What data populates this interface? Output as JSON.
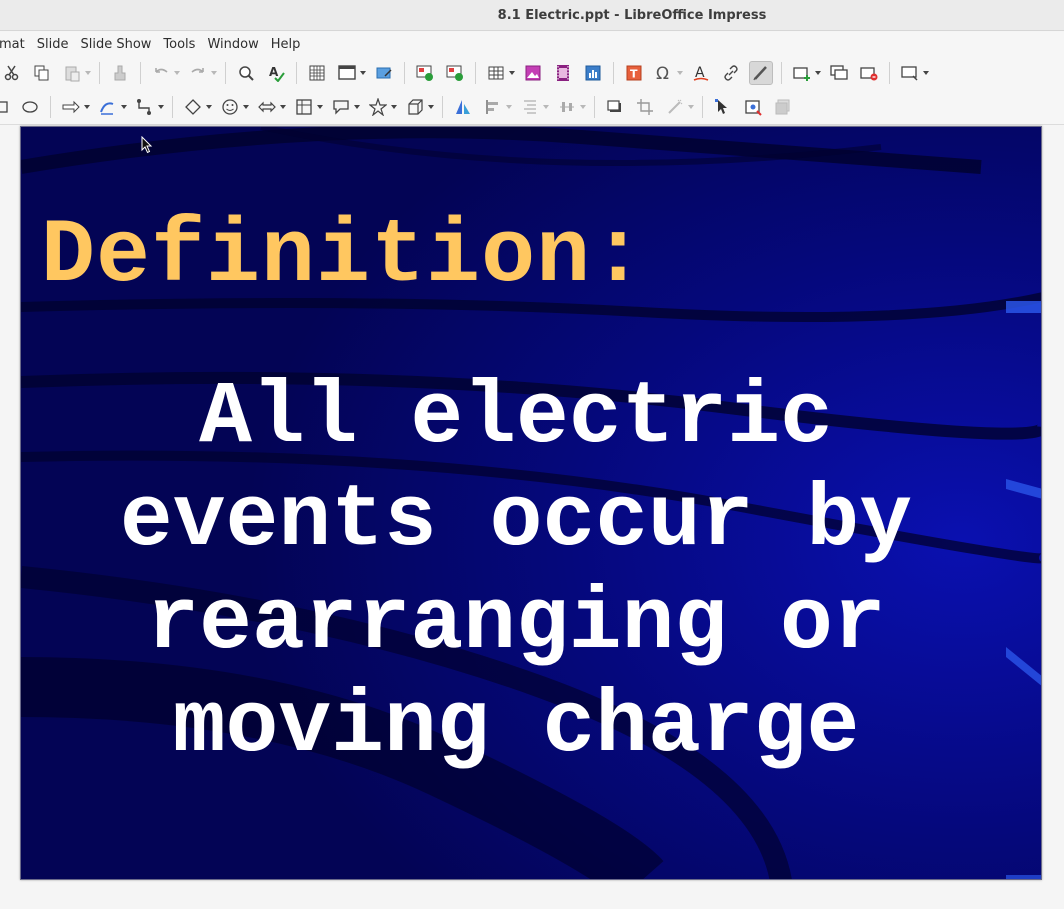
{
  "window": {
    "title": "8.1 Electric.ppt - LibreOffice Impress"
  },
  "menu": {
    "items": [
      "mat",
      "Slide",
      "Slide Show",
      "Tools",
      "Window",
      "Help"
    ]
  },
  "slide": {
    "title": "Definition:",
    "body_lines": [
      "All electric",
      "events occur by",
      "rearranging or",
      "moving charge"
    ]
  },
  "colors": {
    "slide_background": "#04056e",
    "title_text": "#ffc760",
    "body_text": "#ffffff"
  }
}
